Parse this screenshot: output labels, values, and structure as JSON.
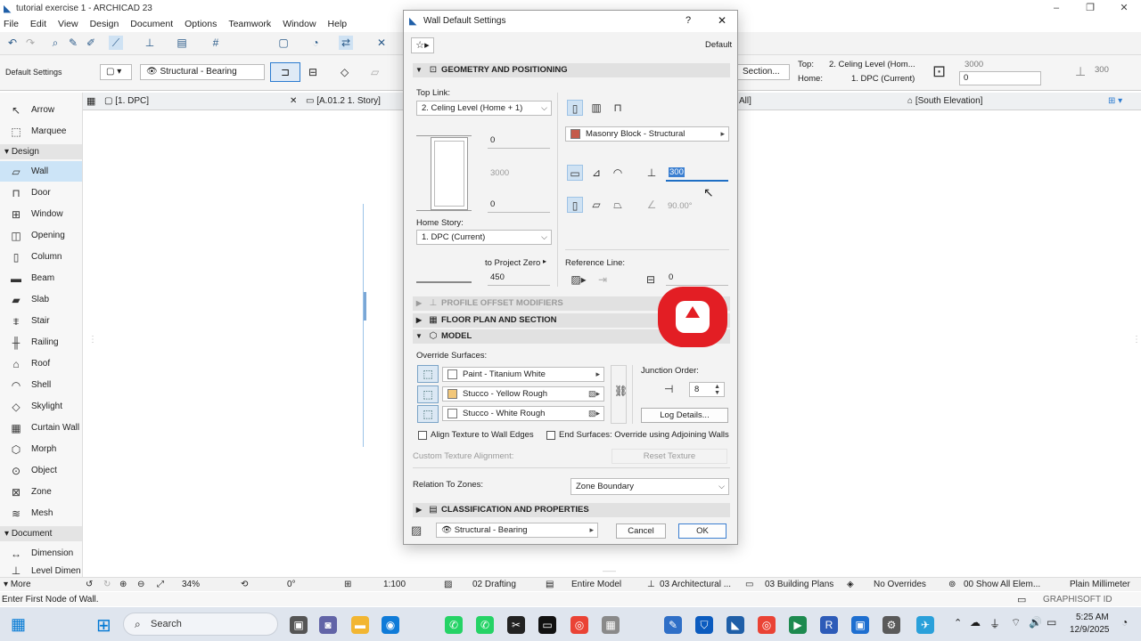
{
  "app": {
    "window_title": "tutorial exercise 1 - ARCHICAD 23",
    "menu": [
      "File",
      "Edit",
      "View",
      "Design",
      "Document",
      "Options",
      "Teamwork",
      "Window",
      "Help"
    ]
  },
  "infobox": {
    "label": "Default Settings",
    "layer": "Structural - Bearing",
    "section": "Section...",
    "top_label": "Top:",
    "top_value": "2. Celing Level (Hom...",
    "home_label": "Home:",
    "home_value": "1. DPC (Current)",
    "height_value": "3000",
    "offset_value": "0",
    "thickness_value": "300"
  },
  "tabs": {
    "plan": "[1. DPC]",
    "story": "[A.01.2 1. Story]",
    "all": "All]",
    "elevation": "[South Elevation]"
  },
  "toolbox": {
    "design_header": "Design",
    "document_header": "Document",
    "items": [
      {
        "label": "Arrow",
        "icon": "arrow-icon"
      },
      {
        "label": "Marquee",
        "icon": "marquee-icon"
      },
      {
        "label": "Wall",
        "icon": "wall-icon"
      },
      {
        "label": "Door",
        "icon": "door-icon"
      },
      {
        "label": "Window",
        "icon": "window-icon"
      },
      {
        "label": "Opening",
        "icon": "opening-icon"
      },
      {
        "label": "Column",
        "icon": "column-icon"
      },
      {
        "label": "Beam",
        "icon": "beam-icon"
      },
      {
        "label": "Slab",
        "icon": "slab-icon"
      },
      {
        "label": "Stair",
        "icon": "stair-icon"
      },
      {
        "label": "Railing",
        "icon": "railing-icon"
      },
      {
        "label": "Roof",
        "icon": "roof-icon"
      },
      {
        "label": "Shell",
        "icon": "shell-icon"
      },
      {
        "label": "Skylight",
        "icon": "skylight-icon"
      },
      {
        "label": "Curtain Wall",
        "icon": "curtain-wall-icon"
      },
      {
        "label": "Morph",
        "icon": "morph-icon"
      },
      {
        "label": "Object",
        "icon": "object-icon"
      },
      {
        "label": "Zone",
        "icon": "zone-icon"
      },
      {
        "label": "Mesh",
        "icon": "mesh-icon"
      },
      {
        "label": "Dimension",
        "icon": "dimension-icon"
      },
      {
        "label": "Level Dimen",
        "icon": "level-dimension-icon"
      }
    ],
    "more": "More"
  },
  "dialog": {
    "title": "Wall Default Settings",
    "help": "?",
    "close": "✕",
    "preset": "Default",
    "geometry": {
      "header": "GEOMETRY AND POSITIONING",
      "top_link_label": "Top Link:",
      "top_link_value": "2. Celing Level (Home + 1)",
      "top_offset": "0",
      "height": "3000",
      "bottom_offset": "0",
      "home_story_label": "Home Story:",
      "home_story_value": "1. DPC (Current)",
      "to_project_zero_label": "to Project Zero",
      "to_project_zero_value": "450",
      "building_material": "Masonry Block - Structural",
      "thickness": "300",
      "angle": "90.00°",
      "reference_line_label": "Reference Line:",
      "reference_offset": "0"
    },
    "profile_offset_header": "PROFILE OFFSET MODIFIERS",
    "floor_plan_header": "FLOOR PLAN AND SECTION",
    "model": {
      "header": "MODEL",
      "override_label": "Override Surfaces:",
      "surfaces": [
        {
          "name": "Paint - Titanium White",
          "color": "#ffffff"
        },
        {
          "name": "Stucco - Yellow Rough",
          "color": "#f2c77a"
        },
        {
          "name": "Stucco - White Rough",
          "color": "#ffffff"
        }
      ],
      "junction_label": "Junction Order:",
      "junction_value": "8",
      "log_details": "Log Details...",
      "align_texture": "Align Texture to Wall Edges",
      "end_surfaces": "End Surfaces: Override using Adjoining Walls",
      "custom_texture": "Custom Texture Alignment:",
      "reset_texture": "Reset Texture",
      "relation_label": "Relation To Zones:",
      "relation_value": "Zone Boundary"
    },
    "classification_header": "CLASSIFICATION AND PROPERTIES",
    "footer_layer": "Structural - Bearing",
    "cancel": "Cancel",
    "ok": "OK"
  },
  "statusbar": {
    "zoom": "34%",
    "angle": "0°",
    "scale": "1:100",
    "layer_combo": "02 Drafting",
    "model_view": "Entire Model",
    "pen_set": "03 Architectural ...",
    "mvo": "03 Building Plans",
    "overrides": "No Overrides",
    "renovation": "00 Show All Elem...",
    "dimension": "Plain Millimeter"
  },
  "hint": "Enter First Node of Wall.",
  "brand": "GRAPHISOFT ID",
  "taskbar": {
    "search": "Search",
    "time": "5:25 AM",
    "date": "12/9/2025"
  },
  "colors": {
    "accent": "#0078d4",
    "record_badge": "#e31e24",
    "selected_tool": "#cce4f7"
  }
}
